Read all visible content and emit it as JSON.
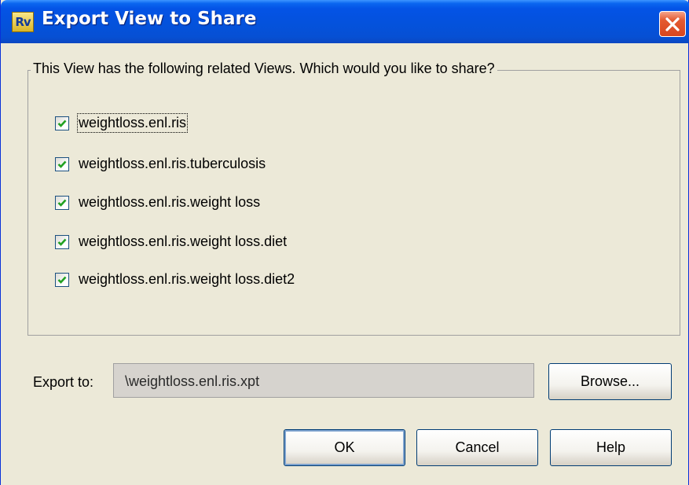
{
  "window": {
    "title": "Export View to Share",
    "app_icon_text": "Rv",
    "close_icon": "close-icon"
  },
  "group": {
    "legend": "This View has the following related Views. Which would you like to share?",
    "items": [
      {
        "label": "weightloss.enl.ris",
        "checked": true
      },
      {
        "label": "weightloss.enl.ris.tuberculosis",
        "checked": true
      },
      {
        "label": "weightloss.enl.ris.weight loss",
        "checked": true
      },
      {
        "label": "weightloss.enl.ris.weight loss.diet",
        "checked": true
      },
      {
        "label": "weightloss.enl.ris.weight loss.diet2",
        "checked": true
      }
    ]
  },
  "export": {
    "label": "Export to:",
    "value": "\\weightloss.enl.ris.xpt",
    "browse_label": "Browse..."
  },
  "buttons": {
    "ok_label": "OK",
    "cancel_label": "Cancel",
    "help_label": "Help"
  },
  "colors": {
    "titlebar": "#0452dc",
    "window_bg": "#ece9d8",
    "checkmark": "#21a121"
  }
}
